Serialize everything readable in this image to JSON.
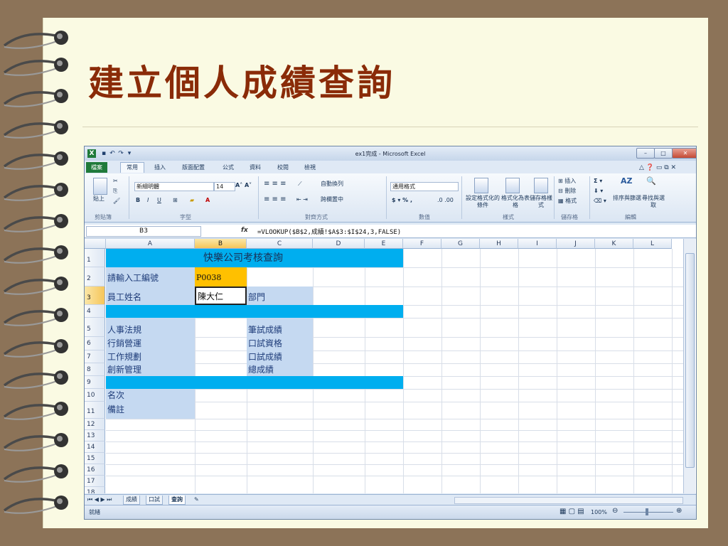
{
  "slide": {
    "title": "建立個人成績查詢"
  },
  "excel": {
    "window_title": "ex1完成 - Microsoft Excel",
    "tabs": [
      "檔案",
      "常用",
      "插入",
      "版面配置",
      "公式",
      "資料",
      "校閱",
      "檢視"
    ],
    "active_tab": "常用",
    "ribbon": {
      "paste": "貼上",
      "font_name": "新細明體",
      "font_size": "14",
      "wrap_text": "自動換列",
      "merge_center": "跨欄置中",
      "number_format": "通用格式",
      "cond_format": "設定格式化的條件",
      "format_table": "格式化為表格",
      "cell_styles": "儲存格樣式",
      "insert": "插入",
      "delete": "刪除",
      "format": "格式",
      "sort_filter": "排序與篩選",
      "find_select": "尋找與選取",
      "groups": [
        "剪貼簿",
        "字型",
        "對齊方式",
        "數值",
        "樣式",
        "儲存格",
        "編輯"
      ]
    },
    "name_box": "B3",
    "fx_label": "fx",
    "formula": "=VLOOKUP($B$2,成績!$A$3:$I$24,3,FALSE)",
    "columns": [
      "A",
      "B",
      "C",
      "D",
      "E",
      "F",
      "G",
      "H",
      "I",
      "J",
      "K",
      "L"
    ],
    "rows": [
      "1",
      "2",
      "3",
      "4",
      "5",
      "6",
      "7",
      "8",
      "9",
      "10",
      "11",
      "12",
      "13",
      "14",
      "15",
      "16",
      "17",
      "18"
    ],
    "cells": {
      "b1": "快樂公司考核查詢",
      "a2": "請輸入工編號",
      "b2": "P0038",
      "a3": "員工姓名",
      "b3": "陳大仁",
      "c3": "部門",
      "a5": "人事法規",
      "c5": "筆試成績",
      "a6": "行銷營運",
      "c6": "口試資格",
      "a7": "工作規劃",
      "c7": "口試成績",
      "a8": "創新管理",
      "c8": "總成績",
      "a10": "名次",
      "a11": "備註"
    },
    "sheet_tabs": [
      "成績",
      "口試",
      "查詢"
    ],
    "active_sheet": "查詢",
    "status": "就緒",
    "zoom": "100%",
    "colors": {
      "band": "#00aeef",
      "label_fill": "#c5d9f1",
      "id_fill": "#ffc000",
      "title_color": "#8a2b08",
      "excel_green": "#1f7a3a"
    }
  }
}
